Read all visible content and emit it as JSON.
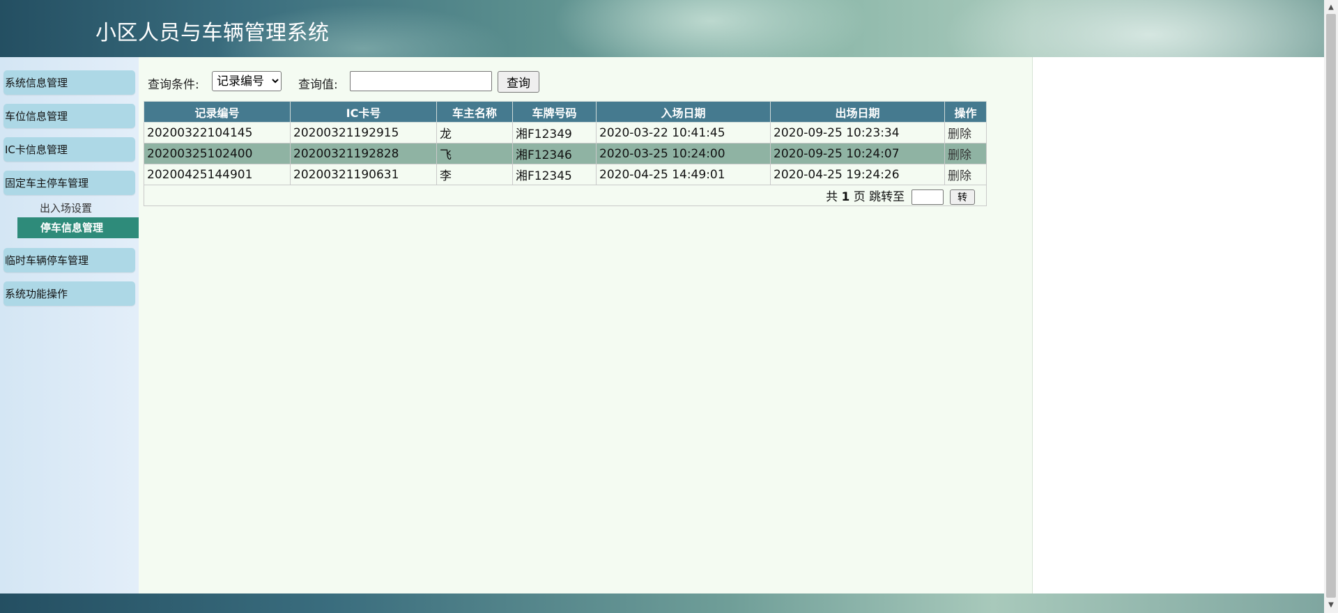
{
  "header": {
    "title": "小区人员与车辆管理系统"
  },
  "sidebar": {
    "items": [
      {
        "label": "系统信息管理"
      },
      {
        "label": "车位信息管理"
      },
      {
        "label": "IC卡信息管理"
      },
      {
        "label": "固定车主停车管理"
      },
      {
        "label": "临时车辆停车管理"
      },
      {
        "label": "系统功能操作"
      }
    ],
    "subitems": [
      {
        "label": "出入场设置"
      },
      {
        "label": "停车信息管理"
      }
    ]
  },
  "query": {
    "condition_label": "查询条件:",
    "condition_selected": "记录编号",
    "value_label": "查询值:",
    "value": "",
    "button_label": "查询"
  },
  "table": {
    "headers": [
      "记录编号",
      "IC卡号",
      "车主名称",
      "车牌号码",
      "入场日期",
      "出场日期",
      "操作"
    ],
    "rows": [
      {
        "record_id": "20200322104145",
        "ic_card": "20200321192915",
        "owner": "龙",
        "plate": "湘F12349",
        "entry": "2020-03-22 10:41:45",
        "exit": "2020-09-25 10:23:34",
        "action": "删除"
      },
      {
        "record_id": "20200325102400",
        "ic_card": "20200321192828",
        "owner": "飞",
        "plate": "湘F12346",
        "entry": "2020-03-25 10:24:00",
        "exit": "2020-09-25 10:24:07",
        "action": "删除"
      },
      {
        "record_id": "20200425144901",
        "ic_card": "20200321190631",
        "owner": "李",
        "plate": "湘F12345",
        "entry": "2020-04-25 14:49:01",
        "exit": "2020-04-25 19:24:26",
        "action": "删除"
      }
    ],
    "highlighted_row": 1
  },
  "pager": {
    "prefix": "共",
    "total_pages": "1",
    "suffix": "页 跳转至",
    "jump_value": "",
    "go_label": "转"
  },
  "icons": {
    "scroll_up": "triangle-up-icon",
    "scroll_down": "triangle-down-icon"
  },
  "colors": {
    "table_header": "#457a8f",
    "menu_item": "#add8e6",
    "active_subitem": "#2e8b7a",
    "highlighted_row": "#8fb3a3",
    "content_bg": "#f4fbf2"
  }
}
